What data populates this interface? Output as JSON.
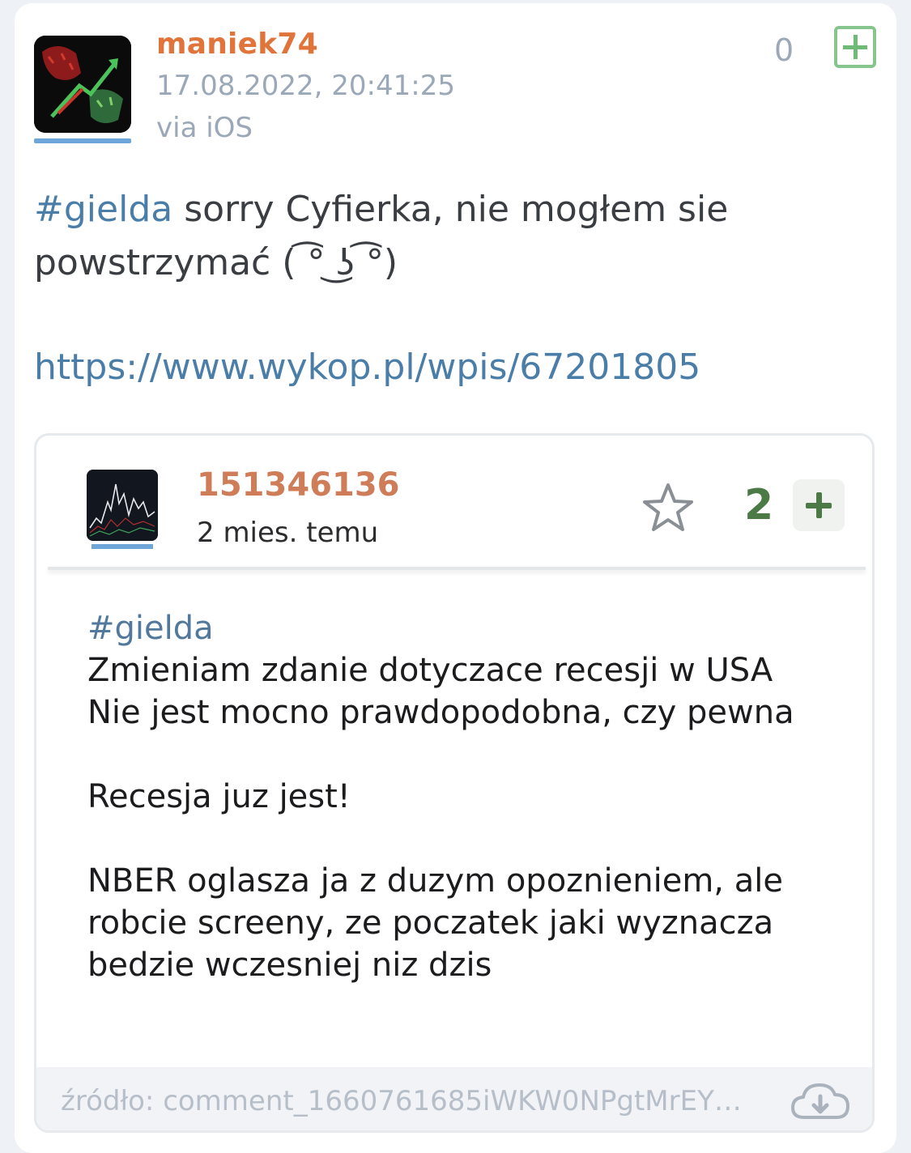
{
  "post": {
    "author": "maniek74",
    "timestamp": "17.08.2022, 20:41:25",
    "via": "via iOS",
    "vote_count": "0",
    "body_tag": "#gielda",
    "body_text": " sorry Cyfierka, nie mogłem sie powstrzymać ( ͡° ͜ʖ ͡°)",
    "link": "https://www.wykop.pl/wpis/67201805"
  },
  "embed": {
    "author": "151346136",
    "time": "2 mies. temu",
    "vote_count": "2",
    "tag": "#gielda",
    "lines": [
      "Zmieniam zdanie dotyczace recesji w USA",
      "Nie jest mocno prawdopodobna, czy pewna",
      "",
      "Recesja juz jest!",
      "",
      "NBER oglasza ja z duzym opoznieniem, ale",
      "robcie screeny, ze poczatek jaki wyznacza",
      "bedzie wczesniej niz dzis"
    ],
    "source": "źródło: comment_1660761685iWKW0NPgtMrEY5..."
  },
  "icons": {
    "star": "star-icon",
    "plus": "plus-icon",
    "download": "cloud-download-icon"
  },
  "colors": {
    "author": "#e0743a",
    "link": "#4a7ea8",
    "plus_green": "#6fba77",
    "embed_green": "#4b7a47"
  }
}
